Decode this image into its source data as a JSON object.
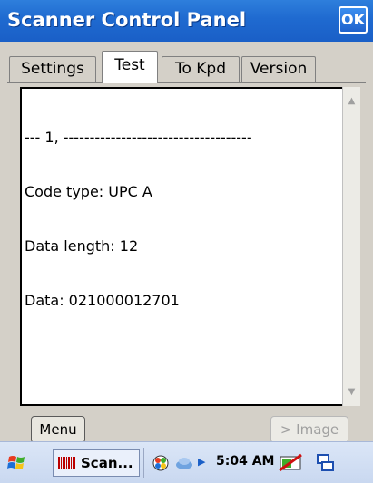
{
  "window": {
    "title": "Scanner Control Panel",
    "ok_label": "OK"
  },
  "tabs": [
    {
      "label": "Settings",
      "active": false
    },
    {
      "label": "Test",
      "active": true
    },
    {
      "label": "To Kpd",
      "active": false
    },
    {
      "label": "Version",
      "active": false
    }
  ],
  "output": {
    "lines": [
      "--- 1, ------------------------------------",
      "Code type: UPC A",
      "Data length: 12",
      "Data: 021000012701"
    ]
  },
  "buttons": {
    "menu_label": "Menu",
    "image_label": "> Image"
  },
  "taskbar": {
    "task_label": "Scan...",
    "time": "5:04 AM",
    "icons": [
      "windows-flag-icon",
      "barcode-icon",
      "network-icon",
      "bluetooth-icon",
      "expand-arrow-icon",
      "battery-icon",
      "keyboard-icon"
    ]
  },
  "colors": {
    "titlebar": "#1f6ad0",
    "taskbar": "#c9d8f0",
    "window_bg": "#d4d0c8"
  }
}
